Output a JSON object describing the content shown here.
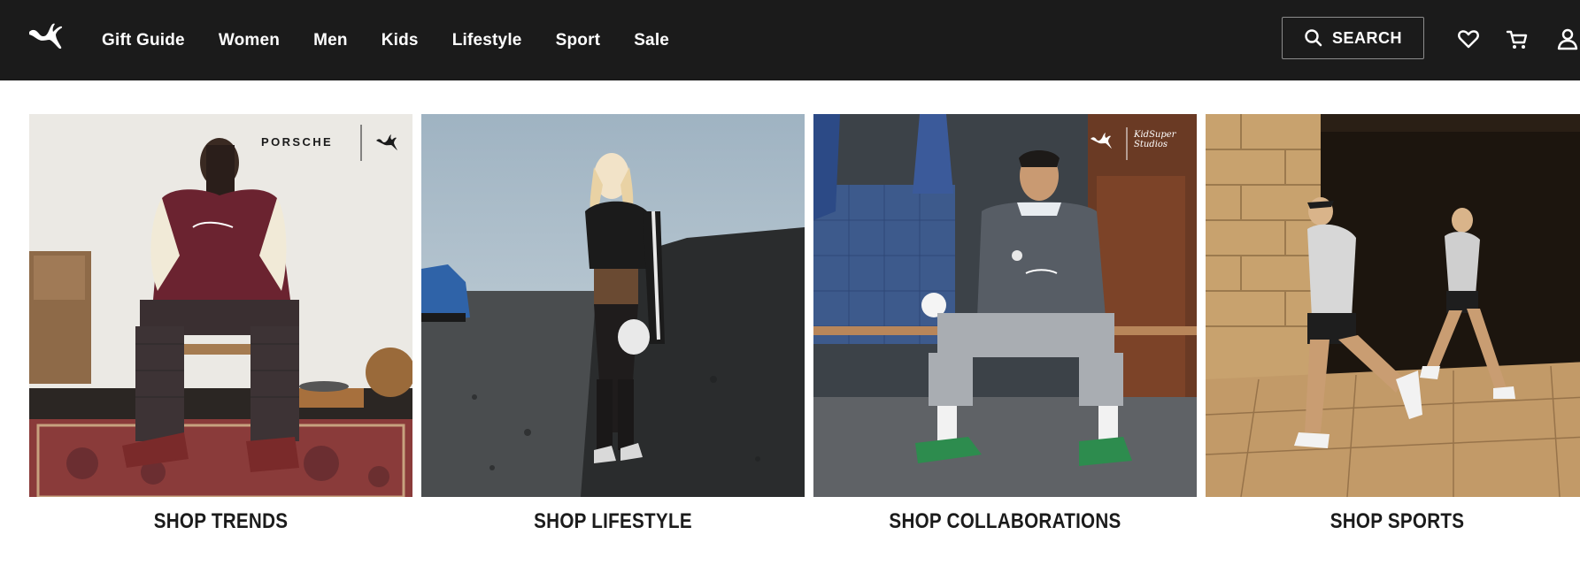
{
  "header": {
    "logo": "puma-cat-logo",
    "nav": [
      "Gift Guide",
      "Women",
      "Men",
      "Kids",
      "Lifestyle",
      "Sport",
      "Sale"
    ],
    "search_label": "SEARCH",
    "icons": [
      "search-icon",
      "heart-icon",
      "cart-icon",
      "account-icon"
    ]
  },
  "tiles": [
    {
      "label": "SHOP TRENDS",
      "brand_text": "PORSCHE"
    },
    {
      "label": "SHOP LIFESTYLE"
    },
    {
      "label": "SHOP COLLABORATIONS",
      "brand_text": "KidSuper Studios"
    },
    {
      "label": "SHOP SPORTS"
    }
  ],
  "colors": {
    "header_bg": "#1b1b1b",
    "text": "#1b1b1b",
    "white": "#ffffff"
  }
}
